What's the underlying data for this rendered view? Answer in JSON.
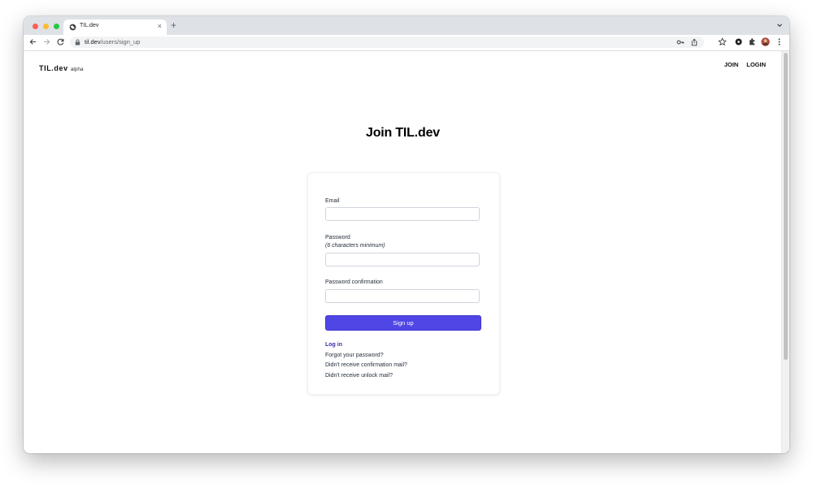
{
  "browser": {
    "tab_title": "TIL.dev",
    "new_tab": "+",
    "tab_close": "×",
    "url_host": "til.dev",
    "url_path": "/users/sign_up",
    "traffic_lights": [
      "#ff5f57",
      "#febc2e",
      "#28c840"
    ],
    "icons": [
      "globe-icon",
      "back-arrow-icon",
      "forward-arrow-icon",
      "reload-icon",
      "lock-icon",
      "key-icon",
      "share-icon",
      "star-icon",
      "extension-dark-icon",
      "puzzle-icon",
      "profile-avatar",
      "kebab-menu-icon",
      "chevron-down-icon"
    ]
  },
  "site": {
    "brand": "TIL.dev",
    "brand_tag": "alpha",
    "nav": {
      "join": "JOIN",
      "login": "LOGIN"
    }
  },
  "form": {
    "title": "Join TIL.dev",
    "email_label": "Email",
    "email_value": "",
    "password_label": "Password",
    "password_hint": "(6 characters minimum)",
    "password_value": "",
    "confirm_label": "Password confirmation",
    "confirm_value": "",
    "submit_label": "Sign up",
    "accent_color": "#4f46e5"
  },
  "links": {
    "login": "Log in",
    "forgot": "Forgot your password?",
    "confirmation": "Didn't receive confirmation mail?",
    "unlock": "Didn't receive unlock mail?"
  }
}
